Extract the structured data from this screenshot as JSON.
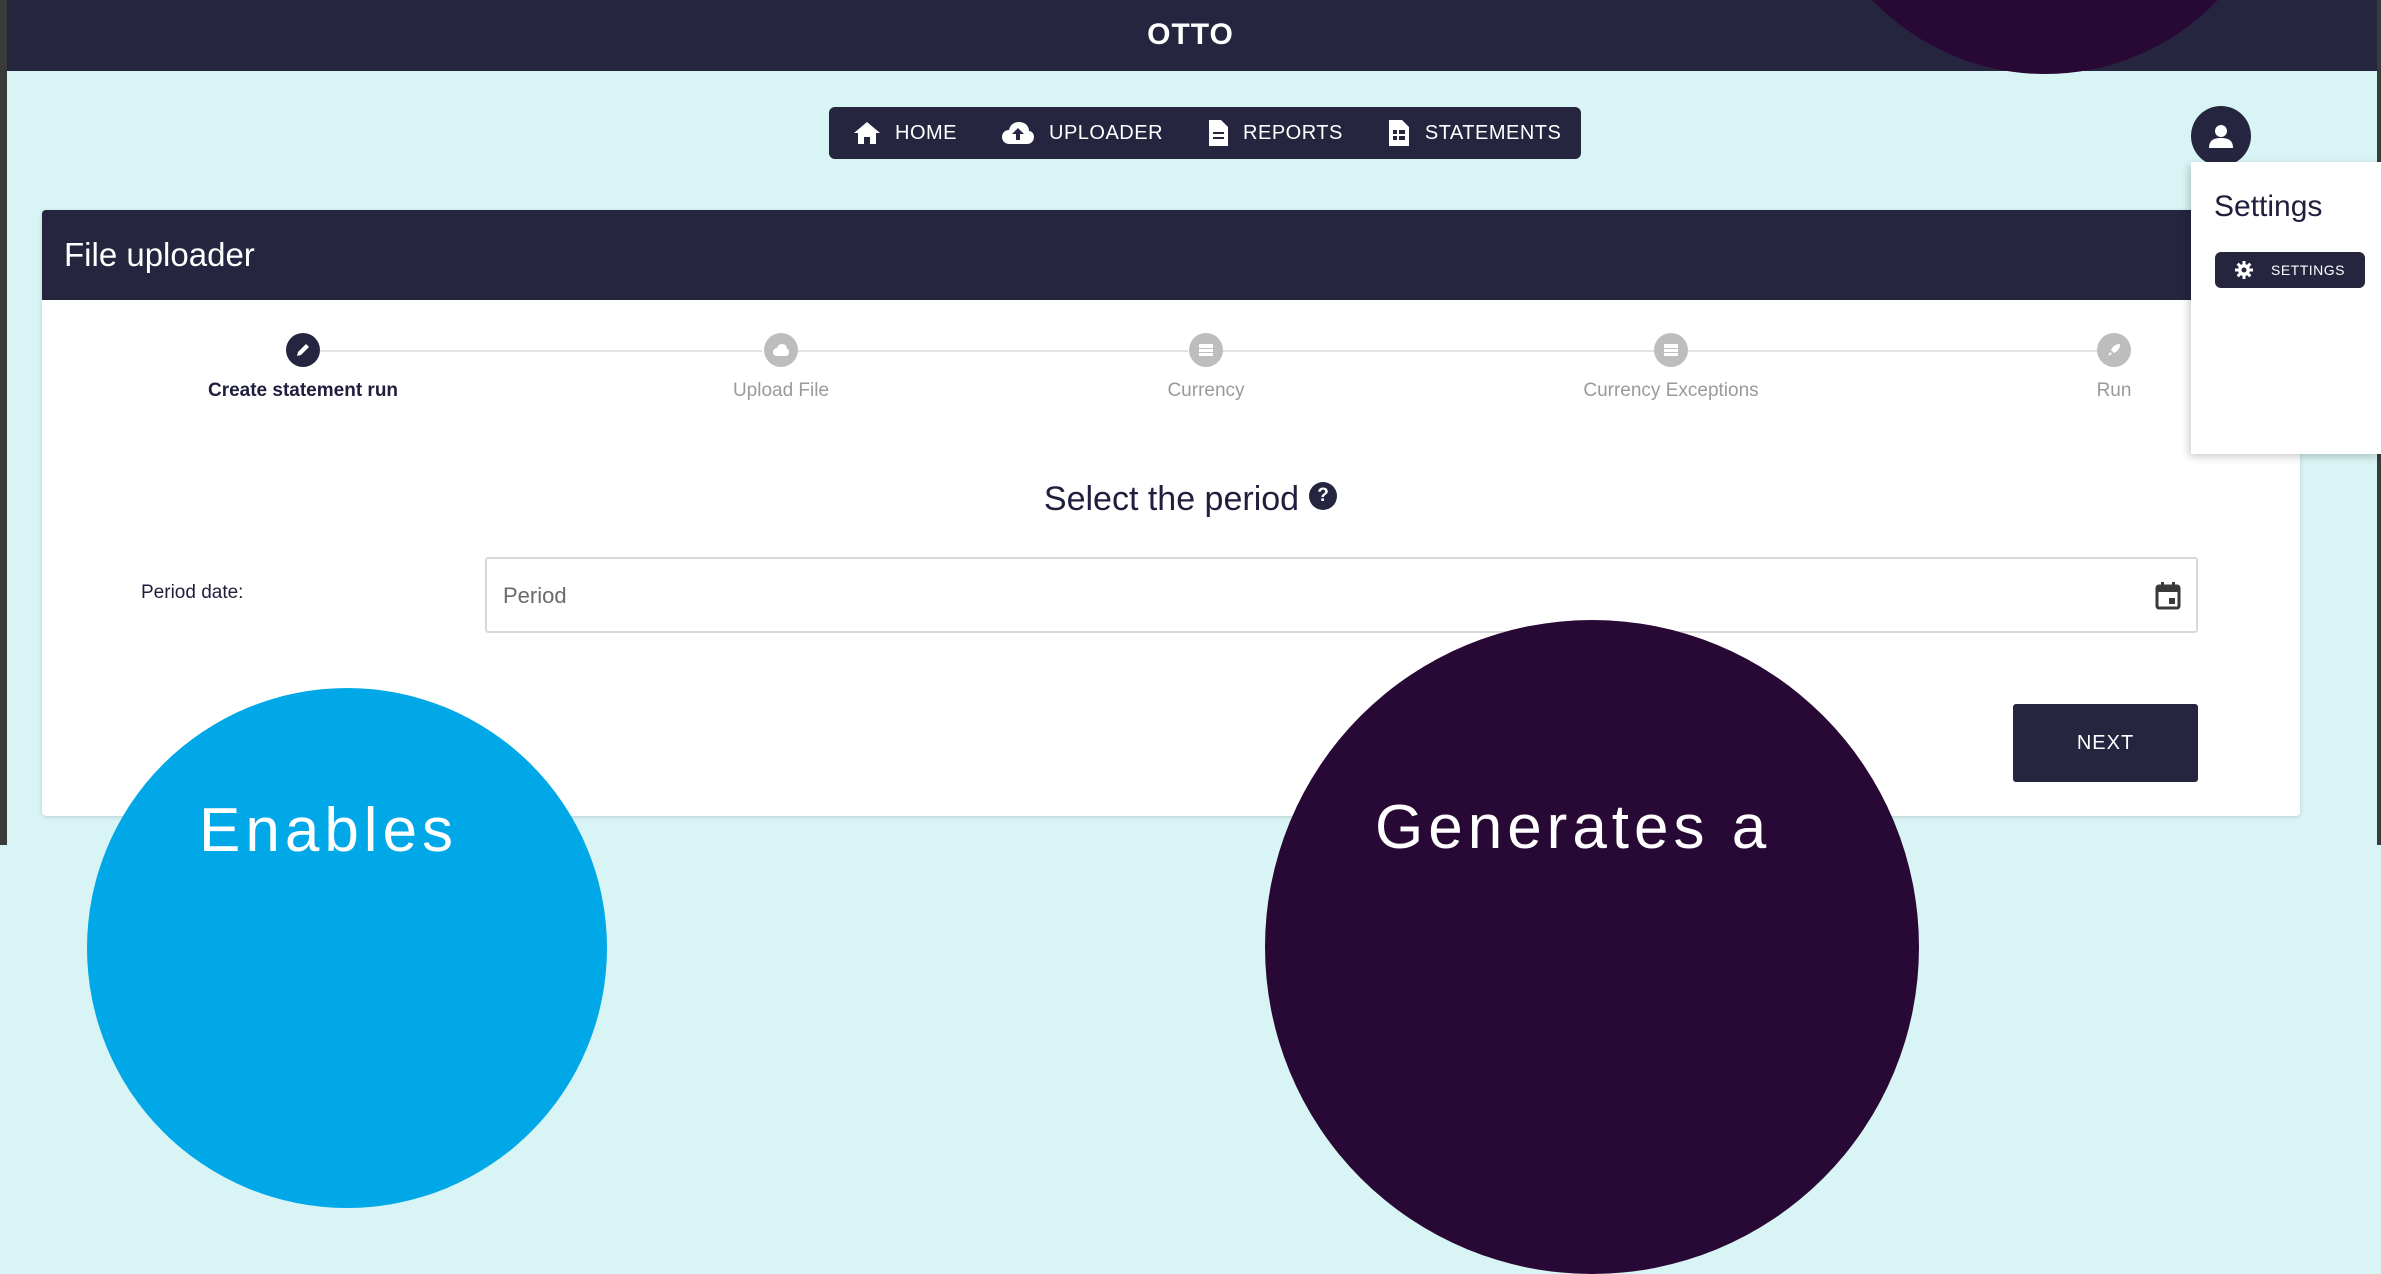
{
  "app": {
    "title": "OTTO"
  },
  "nav": {
    "items": [
      {
        "label": "HOME",
        "icon": "home-icon"
      },
      {
        "label": "UPLOADER",
        "icon": "cloud-upload-icon"
      },
      {
        "label": "REPORTS",
        "icon": "document-icon"
      },
      {
        "label": "STATEMENTS",
        "icon": "statement-icon"
      }
    ]
  },
  "user_menu": {
    "title": "Settings",
    "settings_button": "SETTINGS"
  },
  "card": {
    "title": "File uploader"
  },
  "stepper": {
    "steps": [
      {
        "label": "Create statement run",
        "icon": "pencil-icon",
        "active": true
      },
      {
        "label": "Upload File",
        "icon": "cloud-icon",
        "active": false
      },
      {
        "label": "Currency",
        "icon": "table-icon",
        "active": false
      },
      {
        "label": "Currency Exceptions",
        "icon": "table-icon",
        "active": false
      },
      {
        "label": "Run",
        "icon": "rocket-icon",
        "active": false
      }
    ]
  },
  "form": {
    "heading": "Select the period",
    "help": "?",
    "period_label": "Period date:",
    "period_placeholder": "Period",
    "period_value": "",
    "next_button": "NEXT"
  },
  "overlay": {
    "blue_text": "Enables",
    "purple_text": "Generates a"
  },
  "colors": {
    "navy": "#25253f",
    "background": "#d8f4f4",
    "accent_blue": "#00a8e8",
    "dark_purple": "#280834"
  }
}
